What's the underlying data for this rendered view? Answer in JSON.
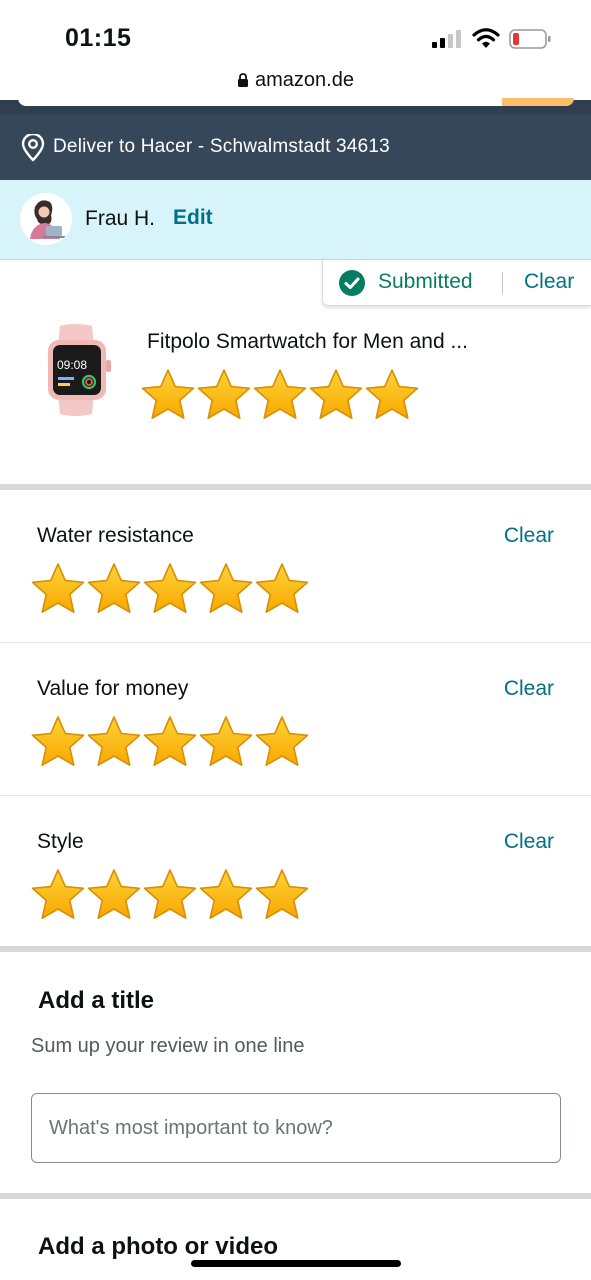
{
  "status_bar": {
    "time": "01:15",
    "signal_icon": "cellular-signal-icon",
    "wifi_icon": "wifi-icon",
    "battery_icon": "battery-low-icon"
  },
  "browser": {
    "url": "amazon.de",
    "lock_icon": "lock-icon"
  },
  "delivery": {
    "icon": "location-pin-icon",
    "text": "Deliver to Hacer - Schwalmstadt 34613"
  },
  "profile": {
    "name": "Frau H.",
    "edit_label": "Edit"
  },
  "overall_rating": {
    "status_label": "Submitted",
    "clear_label": "Clear",
    "product_title": "Fitpolo Smartwatch for Men and ...",
    "rating": 5,
    "max_rating": 5,
    "watch_face_time": "09:08"
  },
  "attributes": [
    {
      "label": "Water resistance",
      "clear_label": "Clear",
      "rating": 5
    },
    {
      "label": "Value for money",
      "clear_label": "Clear",
      "rating": 5
    },
    {
      "label": "Style",
      "clear_label": "Clear",
      "rating": 5
    }
  ],
  "title_section": {
    "heading": "Add a title",
    "subheading": "Sum up your review in one line",
    "input_placeholder": "What's most important to know?",
    "input_value": ""
  },
  "media_section": {
    "heading": "Add a photo or video"
  },
  "colors": {
    "link": "#007185",
    "submitted_green": "#067d62",
    "star_fill": "#ffb800",
    "deliver_bar": "#37475a",
    "profile_bar": "#d7f4fb"
  }
}
